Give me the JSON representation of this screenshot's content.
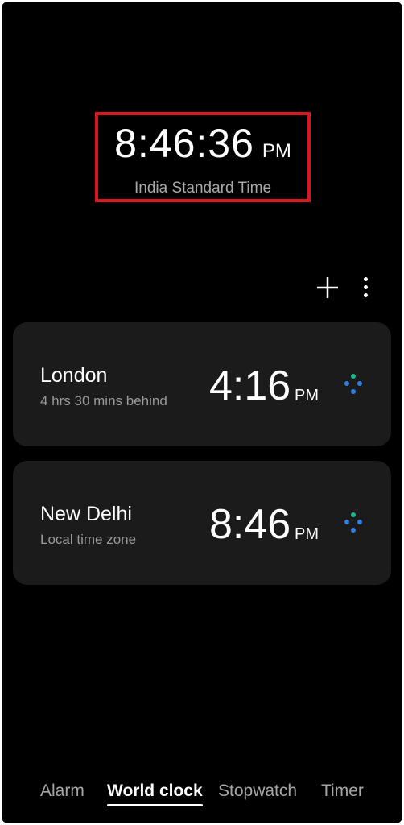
{
  "hero": {
    "time": "8:46:36",
    "ampm": "PM",
    "timezone": "India Standard Time"
  },
  "toolbar": {
    "add_icon": "plus-icon",
    "more_icon": "more-vertical-icon"
  },
  "clocks": [
    {
      "city": "London",
      "subtitle": "4 hrs 30 mins behind",
      "time": "4:16",
      "ampm": "PM"
    },
    {
      "city": "New Delhi",
      "subtitle": "Local time zone",
      "time": "8:46",
      "ampm": "PM"
    }
  ],
  "nav": {
    "items": [
      "Alarm",
      "World clock",
      "Stopwatch",
      "Timer"
    ],
    "active": "World clock"
  },
  "colors": {
    "background": "#000000",
    "card": "#1b1b1b",
    "highlight_box": "#d8171e",
    "dot_green": "#1bb68a",
    "dot_blue": "#2f7fe6"
  }
}
